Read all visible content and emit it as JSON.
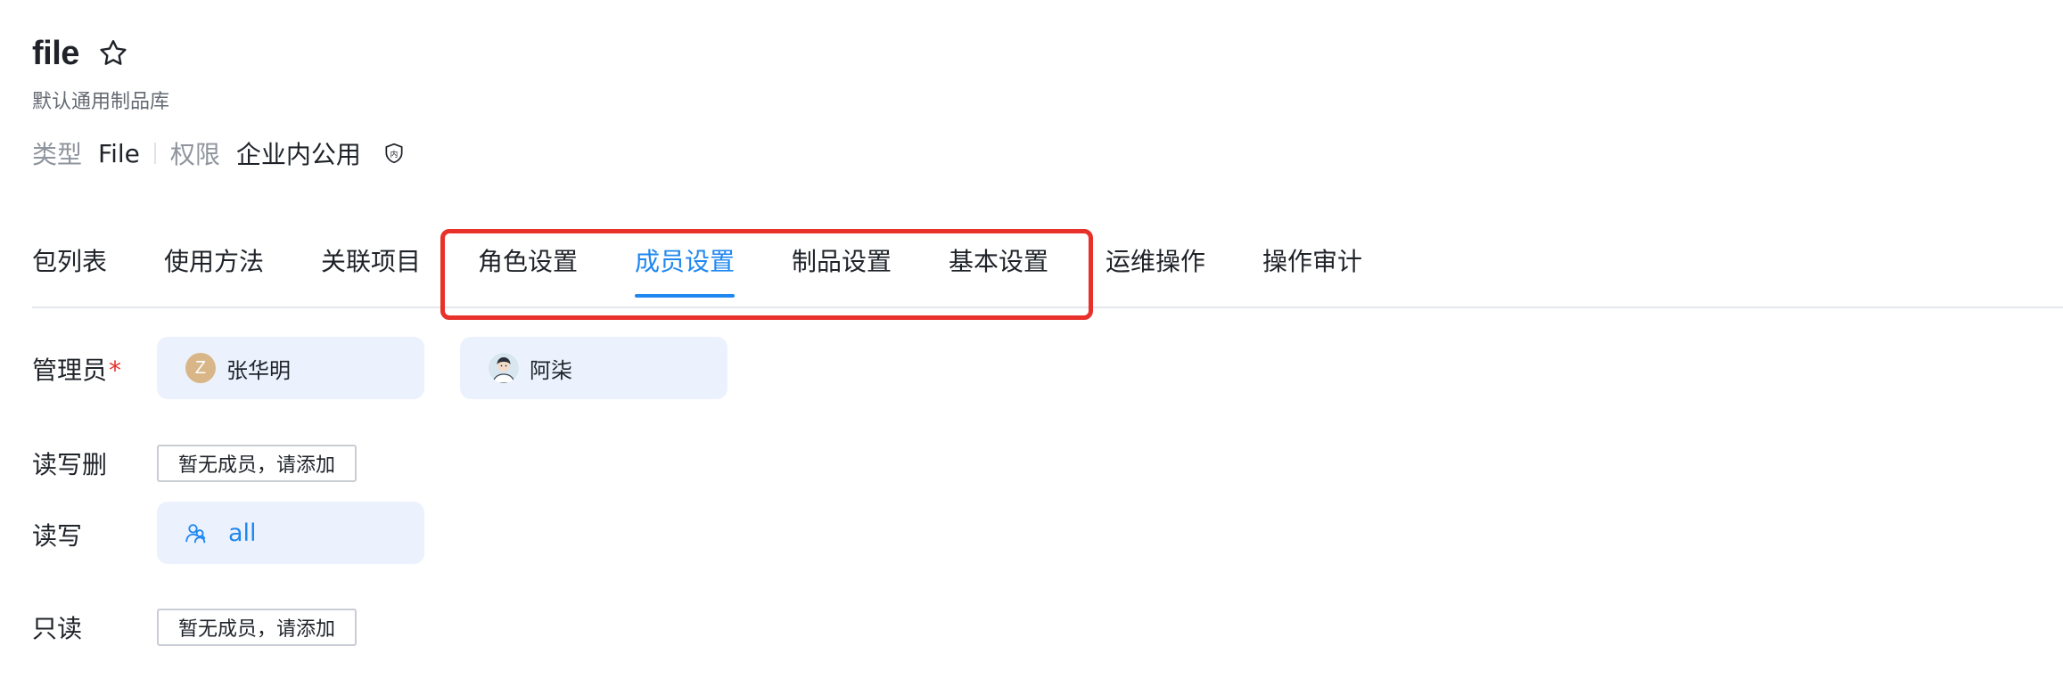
{
  "header": {
    "title": "file",
    "subtitle": "默认通用制品库",
    "type_label": "类型",
    "type_value": "File",
    "permission_label": "权限",
    "permission_value": "企业内公用",
    "shield_text": "内"
  },
  "tabs": [
    {
      "label": "包列表",
      "active": false
    },
    {
      "label": "使用方法",
      "active": false
    },
    {
      "label": "关联项目",
      "active": false
    },
    {
      "label": "角色设置",
      "active": false
    },
    {
      "label": "成员设置",
      "active": true
    },
    {
      "label": "制品设置",
      "active": false
    },
    {
      "label": "基本设置",
      "active": false
    },
    {
      "label": "运维操作",
      "active": false
    },
    {
      "label": "操作审计",
      "active": false
    }
  ],
  "members": {
    "admin": {
      "label": "管理员",
      "required_mark": "*",
      "users": [
        {
          "initial": "Z",
          "name": "张华明"
        },
        {
          "name": "阿柒"
        }
      ]
    },
    "read_write_delete": {
      "label": "读写删",
      "empty_text": "暂无成员，请添加"
    },
    "read_write": {
      "label": "读写",
      "group": "all"
    },
    "read_only": {
      "label": "只读",
      "empty_text": "暂无成员，请添加"
    }
  },
  "colors": {
    "accent": "#1e87f0",
    "highlight": "#e8312a",
    "chip_bg": "#ecf2fd"
  }
}
